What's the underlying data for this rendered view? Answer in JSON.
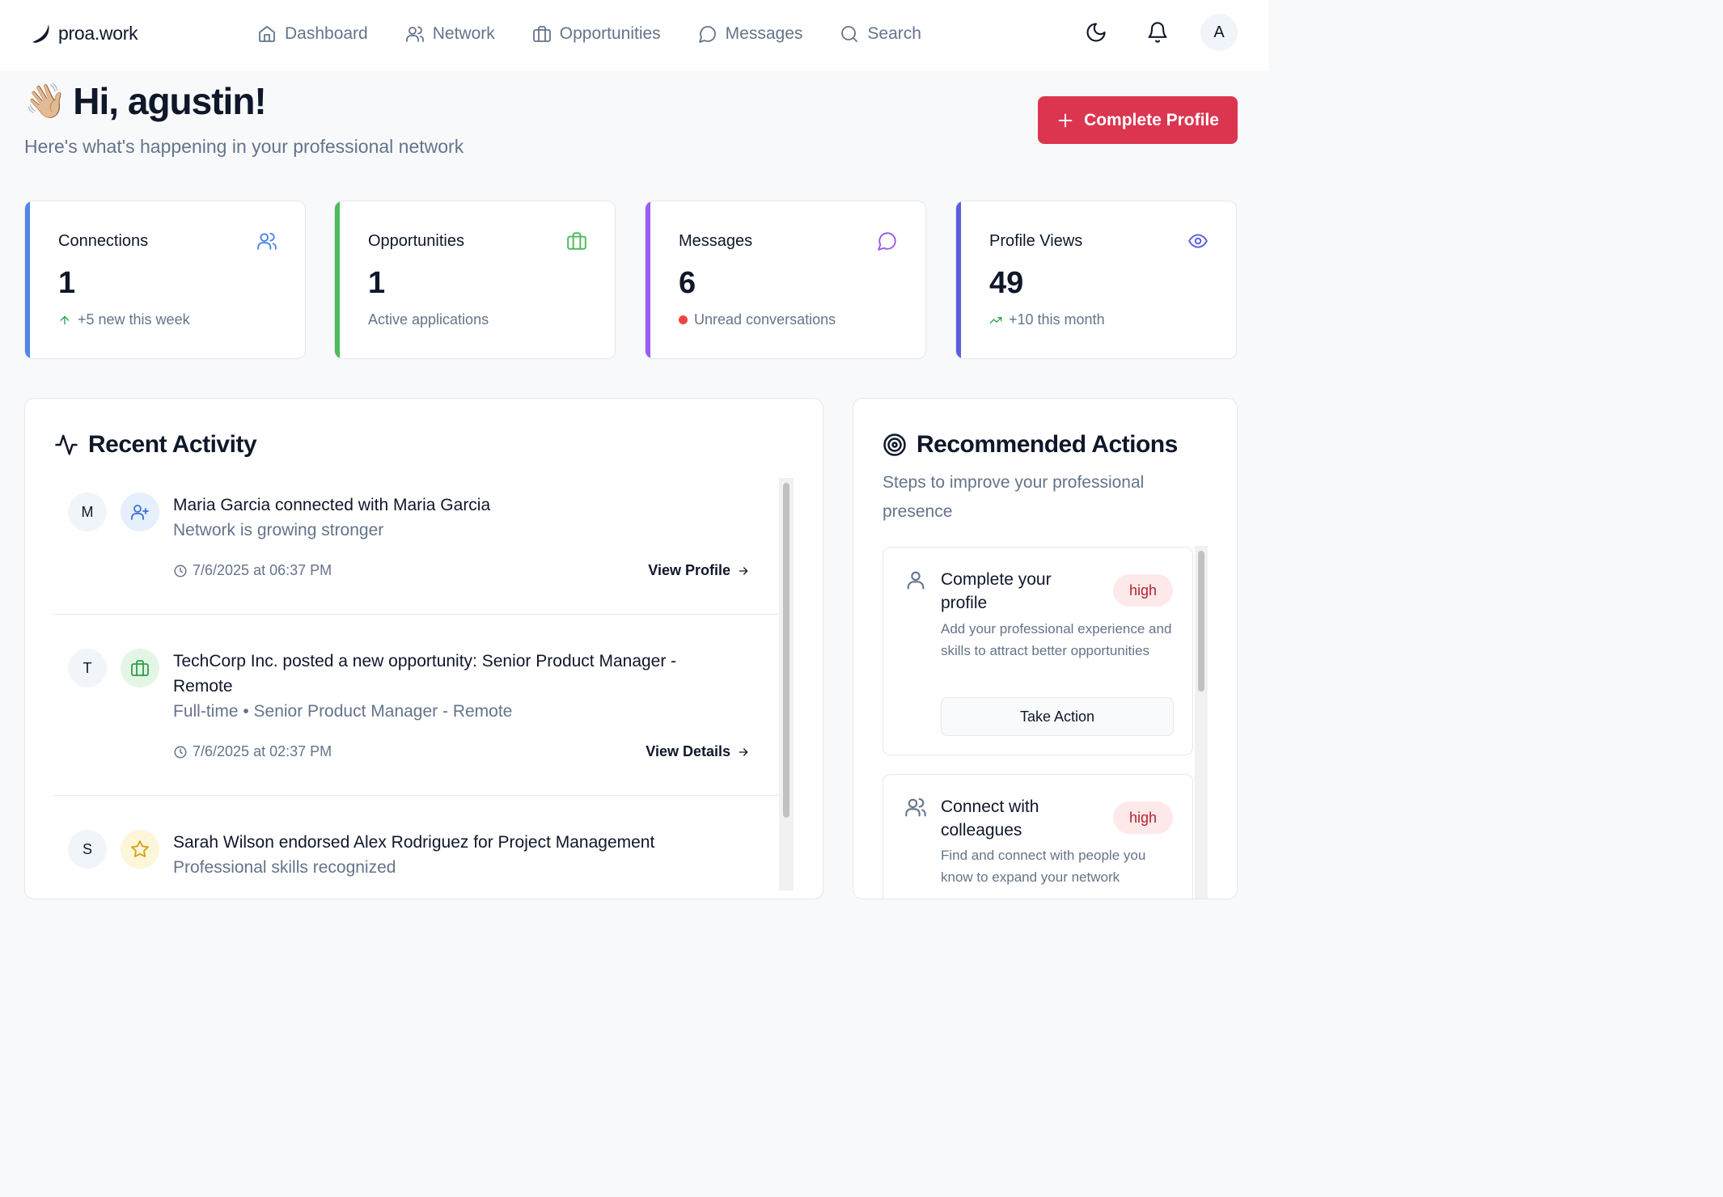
{
  "brand": {
    "name_bold": "proa",
    "name_rest": ".work"
  },
  "nav": [
    {
      "label": "Dashboard",
      "icon": "home-icon"
    },
    {
      "label": "Network",
      "icon": "users-icon"
    },
    {
      "label": "Opportunities",
      "icon": "briefcase-icon"
    },
    {
      "label": "Messages",
      "icon": "chat-icon"
    },
    {
      "label": "Search",
      "icon": "search-icon"
    }
  ],
  "user": {
    "avatar_letter": "A"
  },
  "greeting": {
    "emoji": "👋🏼",
    "title": "Hi, agustin!",
    "subtitle": "Here's what's happening in your professional network"
  },
  "cta": {
    "label": "Complete Profile"
  },
  "stats": [
    {
      "label": "Connections",
      "value": "1",
      "sub": "+5 new this week",
      "accent": "#4f86e8",
      "icon_color": "#4f86e8"
    },
    {
      "label": "Opportunities",
      "value": "1",
      "sub": "Active applications",
      "accent": "#4cbb5c",
      "icon_color": "#4cbb5c"
    },
    {
      "label": "Messages",
      "value": "6",
      "sub": "Unread conversations",
      "accent": "#9b5cf0",
      "icon_color": "#9b5cf0"
    },
    {
      "label": "Profile Views",
      "value": "49",
      "sub": "+10 this month",
      "accent": "#5b5ee0",
      "icon_color": "#5b5ee0"
    }
  ],
  "activity": {
    "title": "Recent Activity",
    "items": [
      {
        "letter": "M",
        "title": "Maria Garcia connected with Maria Garcia",
        "desc": "Network is growing stronger",
        "time": "7/6/2025 at 06:37 PM",
        "link": "View Profile"
      },
      {
        "letter": "T",
        "title": "TechCorp Inc. posted a new opportunity: Senior Product Manager - Remote",
        "desc": "Full-time • Senior Product Manager - Remote",
        "time": "7/6/2025 at 02:37 PM",
        "link": "View Details"
      },
      {
        "letter": "S",
        "title": "Sarah Wilson endorsed Alex Rodriguez for Project Management",
        "desc": "Professional skills recognized"
      }
    ]
  },
  "recommended": {
    "title": "Recommended Actions",
    "subtitle": "Steps to improve your professional presence",
    "items": [
      {
        "title": "Complete your profile",
        "badge": "high",
        "desc": "Add your professional experience and skills to attract better opportunities",
        "button": "Take Action"
      },
      {
        "title": "Connect with colleagues",
        "badge": "high",
        "desc": "Find and connect with people you know to expand your network"
      }
    ]
  }
}
